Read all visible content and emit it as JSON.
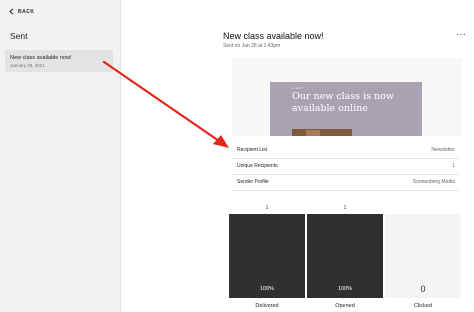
{
  "sidebar": {
    "back_label": "BACK",
    "title": "Sent",
    "items": [
      {
        "title": "New class available now!",
        "date": "January 28, 2021"
      }
    ]
  },
  "header": {
    "title": "New class available now!",
    "subtitle": "Sent on Jan 28 at 1:43pm",
    "more_label": "···"
  },
  "preview": {
    "tag": "LIGHT",
    "heading_line1": "Our new class is now",
    "heading_line2": "available online"
  },
  "details": [
    {
      "label": "Recipient List",
      "value": "Newsletter"
    },
    {
      "label": "Unique Recipients",
      "value": "1"
    },
    {
      "label": "Sender Profile",
      "value": "Sonnenberg Media"
    }
  ],
  "stats": [
    {
      "label": "Delivered",
      "count": "1",
      "percent": "100%",
      "fill": 1.0
    },
    {
      "label": "Opened",
      "count": "1",
      "percent": "100%",
      "fill": 1.0
    },
    {
      "label": "Clicked",
      "count": "",
      "percent": "0",
      "fill": 0.0
    }
  ],
  "colors": {
    "annotation_arrow": "#e0281c",
    "bar_fill": "#303030",
    "email_bg": "#a9a2b1"
  }
}
